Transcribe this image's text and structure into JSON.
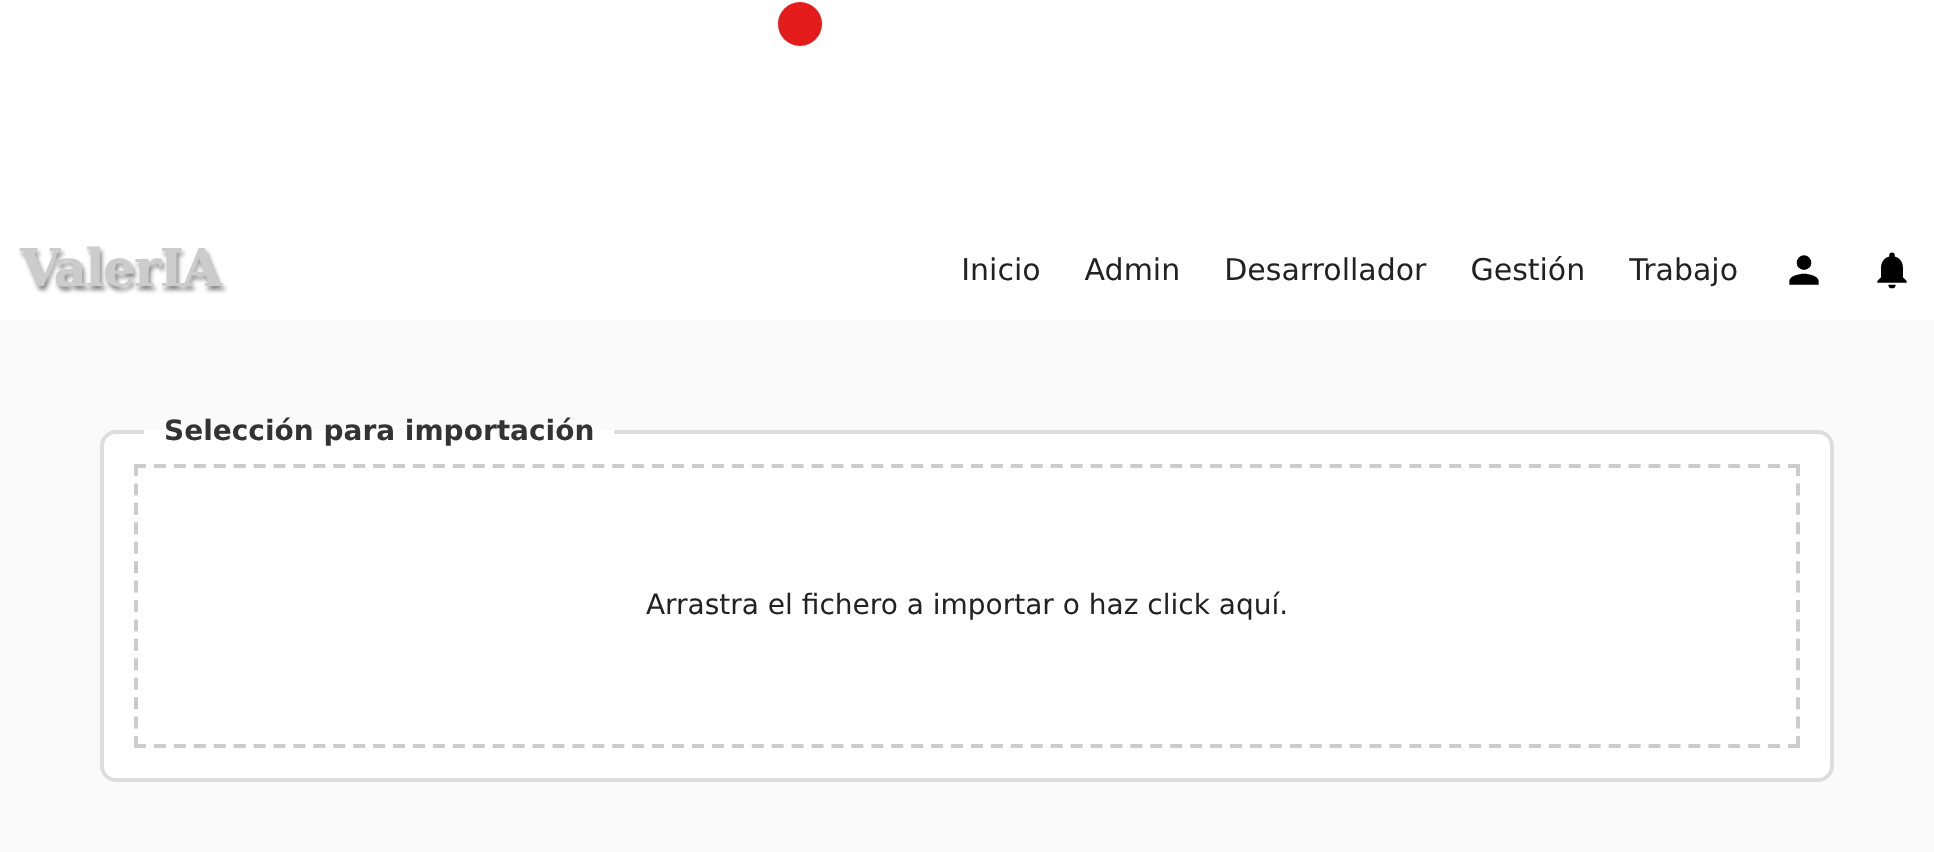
{
  "logo": "ValerIA",
  "nav": [
    {
      "label": "Inicio"
    },
    {
      "label": "Admin"
    },
    {
      "label": "Desarrollador"
    },
    {
      "label": "Gestión"
    },
    {
      "label": "Trabajo"
    }
  ],
  "import": {
    "title": "Selección para importación",
    "dropzone_text": "Arrastra el fichero a importar o haz click aquí."
  }
}
